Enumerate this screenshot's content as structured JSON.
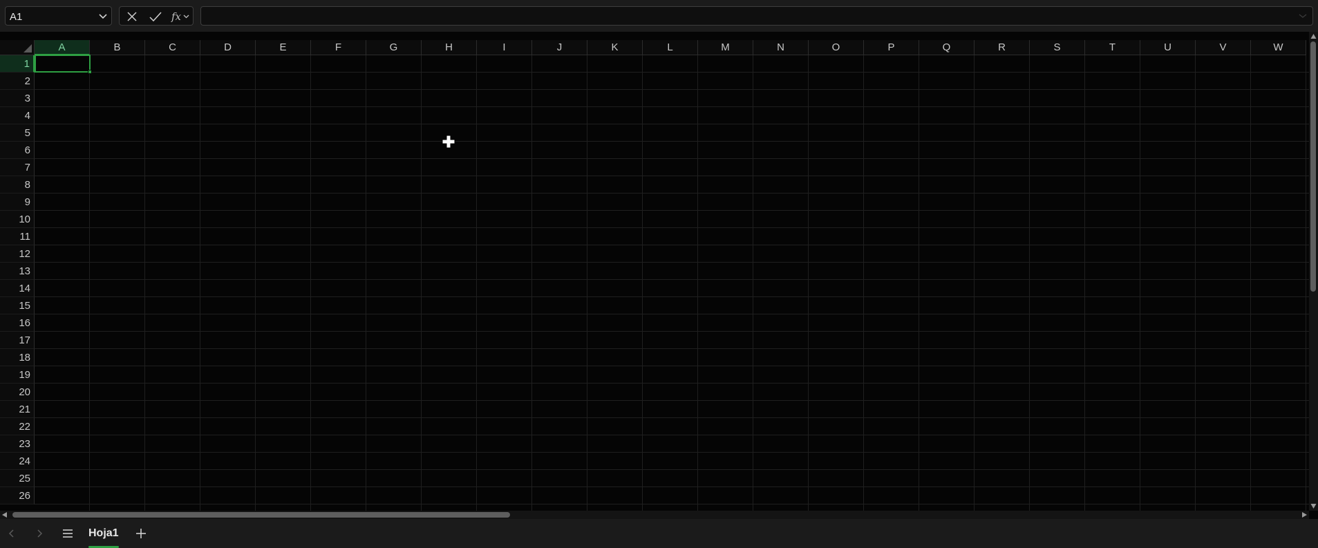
{
  "formula_bar": {
    "name_box": "A1",
    "cancel_icon": "x-icon",
    "enter_icon": "check-icon",
    "function_label": "fx",
    "formula_value": ""
  },
  "grid": {
    "columns": [
      "A",
      "B",
      "C",
      "D",
      "E",
      "F",
      "G",
      "H",
      "I",
      "J",
      "K",
      "L",
      "M",
      "N",
      "O",
      "P",
      "Q",
      "R",
      "S",
      "T",
      "U",
      "V",
      "W"
    ],
    "rows": [
      "1",
      "2",
      "3",
      "4",
      "5",
      "6",
      "7",
      "8",
      "9",
      "10",
      "11",
      "12",
      "13",
      "14",
      "15",
      "16",
      "17",
      "18",
      "19",
      "20",
      "21",
      "22",
      "23",
      "24",
      "25",
      "26"
    ],
    "active_column": "A",
    "active_row": "1",
    "cursor_icon": "cell-select-cross-icon"
  },
  "sheet_tabs": {
    "tabs": [
      {
        "label": "Hoja1",
        "active": true
      }
    ],
    "add_icon": "plus-icon",
    "list_icon": "hamburger-menu-icon"
  },
  "colors": {
    "accent": "#2ea043",
    "background": "#050505",
    "toolbar": "#1b1b1b",
    "gridline": "#1f1f1f"
  }
}
